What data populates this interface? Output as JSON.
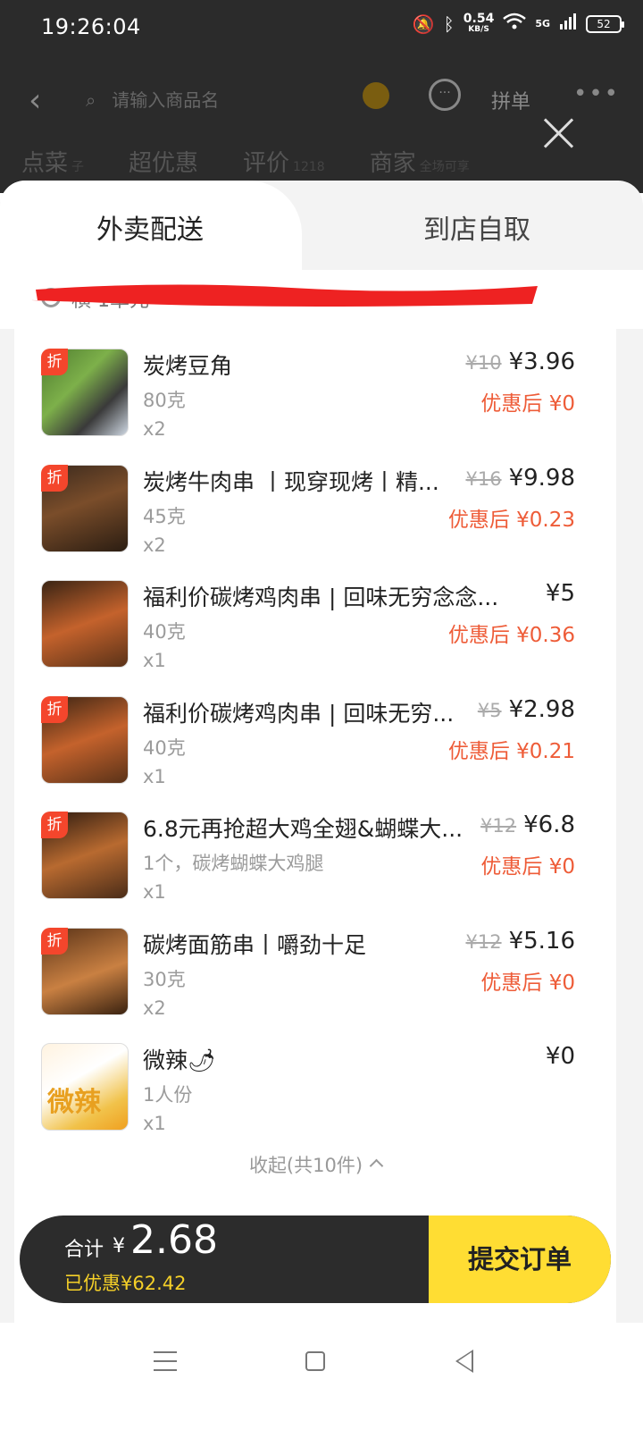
{
  "status_bar": {
    "time": "19:26:04",
    "net_speed": "0.54",
    "net_unit": "KB/S",
    "network": "5G",
    "battery": "52",
    "icons": [
      "bell-muted-icon",
      "bluetooth-icon",
      "wifi-icon",
      "signal-icon",
      "battery-icon"
    ]
  },
  "background": {
    "search_placeholder": "请输入商品名",
    "pin_label": "拼单",
    "tabs": [
      {
        "label": "点菜",
        "sub": "子"
      },
      {
        "label": "超优惠",
        "sub": ""
      },
      {
        "label": "评价",
        "sub": "1218"
      },
      {
        "label": "商家",
        "sub": "全场可享"
      }
    ]
  },
  "sheet": {
    "tab_delivery": "外卖配送",
    "tab_pickup": "到店自取",
    "address_hint": "横  1单元",
    "items": [
      {
        "name": "炭烤豆角",
        "spec": "80克",
        "qty": "x2",
        "old_price": "¥10",
        "price": "¥3.96",
        "after": "优惠后 ¥0",
        "badge": "折"
      },
      {
        "name": "炭烤牛肉串 丨现穿现烤丨精...",
        "spec": "45克",
        "qty": "x2",
        "old_price": "¥16",
        "price": "¥9.98",
        "after": "优惠后 ¥0.23",
        "badge": "折"
      },
      {
        "name": "福利价碳烤鸡肉串 | 回味无穷念念...",
        "spec": "40克",
        "qty": "x1",
        "old_price": "",
        "price": "¥5",
        "after": "优惠后 ¥0.36",
        "badge": ""
      },
      {
        "name": "福利价碳烤鸡肉串 | 回味无穷...",
        "spec": "40克",
        "qty": "x1",
        "old_price": "¥5",
        "price": "¥2.98",
        "after": "优惠后 ¥0.21",
        "badge": "折"
      },
      {
        "name": "6.8元再抢超大鸡全翅&蝴蝶大...",
        "spec": "1个，碳烤蝴蝶大鸡腿",
        "qty": "x1",
        "old_price": "¥12",
        "price": "¥6.8",
        "after": "优惠后 ¥0",
        "badge": "折"
      },
      {
        "name": "碳烤面筋串丨嚼劲十足",
        "spec": "30克",
        "qty": "x2",
        "old_price": "¥12",
        "price": "¥5.16",
        "after": "优惠后 ¥0",
        "badge": "折"
      },
      {
        "name": "微辣🌶",
        "spec": "1人份",
        "qty": "x1",
        "old_price": "",
        "price": "¥0",
        "after": "",
        "badge": "",
        "thumb_text": "微辣"
      }
    ],
    "collapse_label": "收起(共10件)"
  },
  "bottom_bar": {
    "total_label": "合计",
    "currency": "¥",
    "total": "2.68",
    "saved": "已优惠¥62.42",
    "submit": "提交订单"
  },
  "colors": {
    "accent_yellow": "#ffdd33",
    "discount_red": "#ee5c38",
    "badge_red": "#f4462c",
    "dark_bar": "#2c2c2c"
  }
}
